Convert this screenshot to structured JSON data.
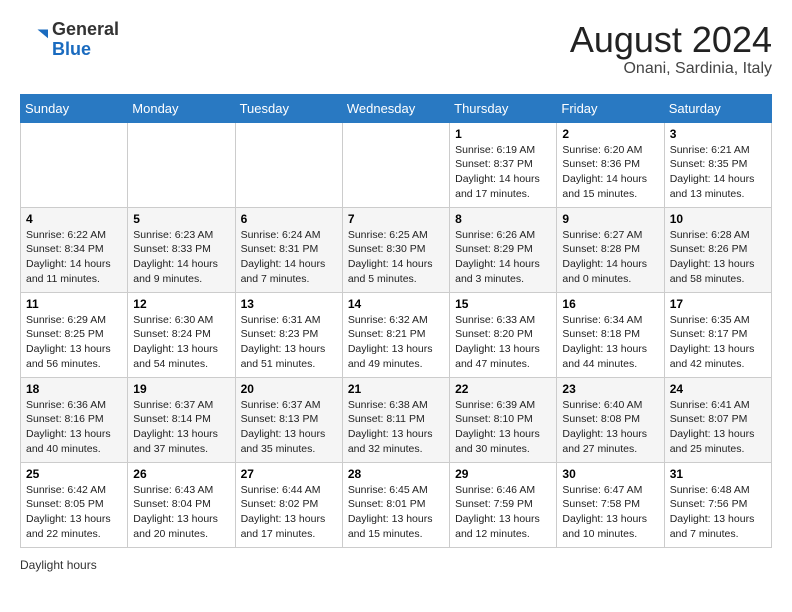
{
  "header": {
    "logo_general": "General",
    "logo_blue": "Blue",
    "month_year": "August 2024",
    "location": "Onani, Sardinia, Italy"
  },
  "weekdays": [
    "Sunday",
    "Monday",
    "Tuesday",
    "Wednesday",
    "Thursday",
    "Friday",
    "Saturday"
  ],
  "weeks": [
    [
      {
        "day": "",
        "info": ""
      },
      {
        "day": "",
        "info": ""
      },
      {
        "day": "",
        "info": ""
      },
      {
        "day": "",
        "info": ""
      },
      {
        "day": "1",
        "info": "Sunrise: 6:19 AM\nSunset: 8:37 PM\nDaylight: 14 hours and 17 minutes."
      },
      {
        "day": "2",
        "info": "Sunrise: 6:20 AM\nSunset: 8:36 PM\nDaylight: 14 hours and 15 minutes."
      },
      {
        "day": "3",
        "info": "Sunrise: 6:21 AM\nSunset: 8:35 PM\nDaylight: 14 hours and 13 minutes."
      }
    ],
    [
      {
        "day": "4",
        "info": "Sunrise: 6:22 AM\nSunset: 8:34 PM\nDaylight: 14 hours and 11 minutes."
      },
      {
        "day": "5",
        "info": "Sunrise: 6:23 AM\nSunset: 8:33 PM\nDaylight: 14 hours and 9 minutes."
      },
      {
        "day": "6",
        "info": "Sunrise: 6:24 AM\nSunset: 8:31 PM\nDaylight: 14 hours and 7 minutes."
      },
      {
        "day": "7",
        "info": "Sunrise: 6:25 AM\nSunset: 8:30 PM\nDaylight: 14 hours and 5 minutes."
      },
      {
        "day": "8",
        "info": "Sunrise: 6:26 AM\nSunset: 8:29 PM\nDaylight: 14 hours and 3 minutes."
      },
      {
        "day": "9",
        "info": "Sunrise: 6:27 AM\nSunset: 8:28 PM\nDaylight: 14 hours and 0 minutes."
      },
      {
        "day": "10",
        "info": "Sunrise: 6:28 AM\nSunset: 8:26 PM\nDaylight: 13 hours and 58 minutes."
      }
    ],
    [
      {
        "day": "11",
        "info": "Sunrise: 6:29 AM\nSunset: 8:25 PM\nDaylight: 13 hours and 56 minutes."
      },
      {
        "day": "12",
        "info": "Sunrise: 6:30 AM\nSunset: 8:24 PM\nDaylight: 13 hours and 54 minutes."
      },
      {
        "day": "13",
        "info": "Sunrise: 6:31 AM\nSunset: 8:23 PM\nDaylight: 13 hours and 51 minutes."
      },
      {
        "day": "14",
        "info": "Sunrise: 6:32 AM\nSunset: 8:21 PM\nDaylight: 13 hours and 49 minutes."
      },
      {
        "day": "15",
        "info": "Sunrise: 6:33 AM\nSunset: 8:20 PM\nDaylight: 13 hours and 47 minutes."
      },
      {
        "day": "16",
        "info": "Sunrise: 6:34 AM\nSunset: 8:18 PM\nDaylight: 13 hours and 44 minutes."
      },
      {
        "day": "17",
        "info": "Sunrise: 6:35 AM\nSunset: 8:17 PM\nDaylight: 13 hours and 42 minutes."
      }
    ],
    [
      {
        "day": "18",
        "info": "Sunrise: 6:36 AM\nSunset: 8:16 PM\nDaylight: 13 hours and 40 minutes."
      },
      {
        "day": "19",
        "info": "Sunrise: 6:37 AM\nSunset: 8:14 PM\nDaylight: 13 hours and 37 minutes."
      },
      {
        "day": "20",
        "info": "Sunrise: 6:37 AM\nSunset: 8:13 PM\nDaylight: 13 hours and 35 minutes."
      },
      {
        "day": "21",
        "info": "Sunrise: 6:38 AM\nSunset: 8:11 PM\nDaylight: 13 hours and 32 minutes."
      },
      {
        "day": "22",
        "info": "Sunrise: 6:39 AM\nSunset: 8:10 PM\nDaylight: 13 hours and 30 minutes."
      },
      {
        "day": "23",
        "info": "Sunrise: 6:40 AM\nSunset: 8:08 PM\nDaylight: 13 hours and 27 minutes."
      },
      {
        "day": "24",
        "info": "Sunrise: 6:41 AM\nSunset: 8:07 PM\nDaylight: 13 hours and 25 minutes."
      }
    ],
    [
      {
        "day": "25",
        "info": "Sunrise: 6:42 AM\nSunset: 8:05 PM\nDaylight: 13 hours and 22 minutes."
      },
      {
        "day": "26",
        "info": "Sunrise: 6:43 AM\nSunset: 8:04 PM\nDaylight: 13 hours and 20 minutes."
      },
      {
        "day": "27",
        "info": "Sunrise: 6:44 AM\nSunset: 8:02 PM\nDaylight: 13 hours and 17 minutes."
      },
      {
        "day": "28",
        "info": "Sunrise: 6:45 AM\nSunset: 8:01 PM\nDaylight: 13 hours and 15 minutes."
      },
      {
        "day": "29",
        "info": "Sunrise: 6:46 AM\nSunset: 7:59 PM\nDaylight: 13 hours and 12 minutes."
      },
      {
        "day": "30",
        "info": "Sunrise: 6:47 AM\nSunset: 7:58 PM\nDaylight: 13 hours and 10 minutes."
      },
      {
        "day": "31",
        "info": "Sunrise: 6:48 AM\nSunset: 7:56 PM\nDaylight: 13 hours and 7 minutes."
      }
    ]
  ],
  "footer": {
    "daylight_hours_label": "Daylight hours"
  }
}
